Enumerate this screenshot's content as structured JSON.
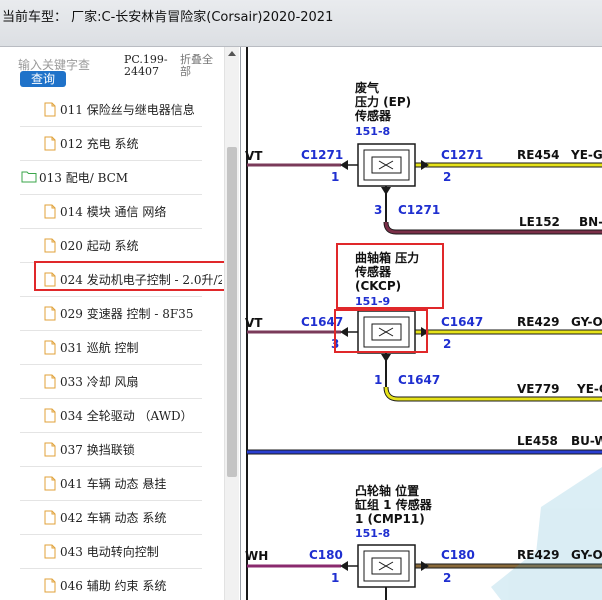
{
  "window": {
    "title": "当前车型：   厂家:C-长安林肯冒险家(Corsair)2020-2021"
  },
  "sidebar": {
    "search": {
      "placeholder": "输入关键字查",
      "button": "查询"
    },
    "pc_code": "PC.199-24407",
    "collapse_all": "折叠全部",
    "items": [
      {
        "label": "011 保险丝与继电器信息",
        "type": "doc"
      },
      {
        "label": "012 充电 系统",
        "type": "doc"
      },
      {
        "label": "013 配电/ BCM",
        "type": "folder"
      },
      {
        "label": "014 模块 通信 网络",
        "type": "doc"
      },
      {
        "label": "020 起动 系统",
        "type": "doc"
      },
      {
        "label": "024 发动机电子控制 - 2.0升/2",
        "type": "doc",
        "highlighted": true
      },
      {
        "label": "029 变速器 控制 - 8F35",
        "type": "doc"
      },
      {
        "label": "031 巡航 控制",
        "type": "doc"
      },
      {
        "label": "033 冷却 风扇",
        "type": "doc"
      },
      {
        "label": "034 全轮驱动 （AWD）",
        "type": "doc"
      },
      {
        "label": "037 换挡联锁",
        "type": "doc"
      },
      {
        "label": "041 车辆 动态 悬挂",
        "type": "doc"
      },
      {
        "label": "042 车辆 动态 系统",
        "type": "doc"
      },
      {
        "label": "043 电动转向控制",
        "type": "doc"
      },
      {
        "label": "046 辅助 约束 系统",
        "type": "doc"
      }
    ]
  },
  "diagram": {
    "sensors": [
      {
        "name_lines": [
          "废气",
          "压力 (EP)",
          "传感器"
        ],
        "code": "151-8",
        "left_label": "VT",
        "left_connector": "C1271",
        "left_pin": "1",
        "right_connector": "C1271",
        "right_pin": "2",
        "bottom_pin": "3",
        "bottom_connector": "C1271",
        "wires": [
          {
            "code": "RE454",
            "color_code": "YE-G"
          },
          {
            "code": "LE152",
            "color_code": "BN-"
          }
        ]
      },
      {
        "name_lines": [
          "曲轴箱 压力",
          "传感器",
          "(CKCP)"
        ],
        "code": "151-9",
        "left_label": "VT",
        "left_connector": "C1647",
        "left_pin": "3",
        "right_connector": "C1647",
        "right_pin": "2",
        "bottom_pin": "1",
        "bottom_connector": "C1647",
        "wires": [
          {
            "code": "RE429",
            "color_code": "GY-O"
          },
          {
            "code": "VE779",
            "color_code": "YE-G"
          },
          {
            "code": "LE458",
            "color_code": "BU-W"
          }
        ]
      },
      {
        "name_lines": [
          "凸轮轴 位置",
          "缸组 1 传感器",
          "1 (CMP11)"
        ],
        "code": "151-8",
        "left_label": "WH",
        "left_connector": "C180",
        "left_pin": "1",
        "right_connector": "C180",
        "right_pin": "2",
        "wires": [
          {
            "code": "RE429",
            "color_code": "GY-O"
          }
        ]
      }
    ],
    "colors": {
      "wire_yellow": "#e6e21a",
      "wire_purple": "#7a3a5a",
      "wire_blue": "#2a3fd0",
      "wire_magenta": "#8a2a6e",
      "connector_blue": "#1f2fd0",
      "highlight_red": "#e0282a"
    }
  }
}
